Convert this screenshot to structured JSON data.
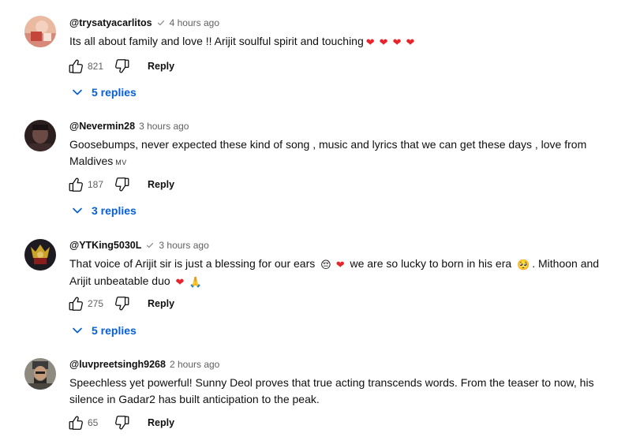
{
  "comments": [
    {
      "author": "@trysatyacarlitos",
      "verified": true,
      "time": "4 hours ago",
      "text": "Its all about family and love !! Arijit soulful spirit and touching",
      "likes": "821",
      "reply_label": "Reply",
      "replies_label": "5 replies"
    },
    {
      "author": "@Nevermin28",
      "verified": false,
      "time": "3 hours ago",
      "text": "Goosebumps, never expected these kind of song , music and lyrics that we can get these days , love from Maldives",
      "flag": "MV",
      "likes": "187",
      "reply_label": "Reply",
      "replies_label": "3 replies"
    },
    {
      "author": "@YTKing5030L",
      "verified": true,
      "time": "3 hours ago",
      "text_part1": "That voice of Arijit sir is just a blessing for our ears",
      "text_part2": "we are so lucky to born in his era",
      "text_part3": ". Mithoon and Arijit unbeatable duo",
      "likes": "275",
      "reply_label": "Reply",
      "replies_label": "5 replies"
    },
    {
      "author": "@luvpreetsingh9268",
      "verified": false,
      "time": "2 hours ago",
      "text": "Speechless yet powerful! Sunny Deol proves that true acting transcends words. From the teaser to now, his silence in Gadar2 has built anticipation to the peak.",
      "likes": "65",
      "reply_label": "Reply"
    }
  ],
  "icons": {
    "like": "thumbs-up-icon",
    "dislike": "thumbs-down-icon",
    "expand": "chevron-down-icon",
    "verified": "check-icon",
    "heart": "heart-emoji",
    "pensive": "pensive-face-emoji",
    "pleading": "pleading-face-emoji",
    "pray": "folded-hands-emoji"
  },
  "colors": {
    "link_blue": "#065fd4",
    "meta_gray": "#606060",
    "heart_red": "#e8232a"
  }
}
